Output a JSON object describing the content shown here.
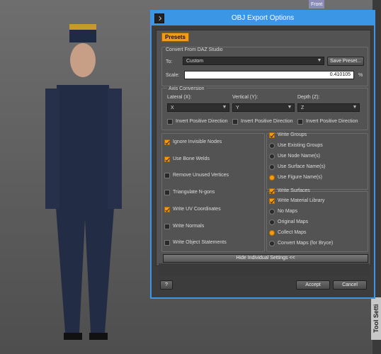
{
  "background": {
    "top_button_label": "Front",
    "side_tab_label": "Tool Setti"
  },
  "dialog": {
    "title": "OBJ Export Options",
    "presets_label": "Presets",
    "convert_group_label": "Convert From DAZ Studio",
    "to_label": "To:",
    "to_value": "Custom",
    "save_preset_label": "Save Preset...",
    "scale_label": "Scale:",
    "scale_value": "0.410105",
    "scale_unit": "%",
    "axis_group_label": "Axis Conversion",
    "lateral_label": "Lateral (X):",
    "vertical_label": "Vertical (Y):",
    "depth_label": "Depth (Z):",
    "lateral_value": "X",
    "vertical_value": "Y",
    "depth_value": "Z",
    "invert_label": "Invert Positive Direction",
    "options_left": [
      {
        "label": "Ignore Invisible Nodes",
        "checked": true
      },
      {
        "label": "Use Bone Welds",
        "checked": true
      },
      {
        "label": "Remove Unused Vertices",
        "checked": false
      },
      {
        "label": "Triangulate N-gons",
        "checked": false
      },
      {
        "label": "Write UV Coordinates",
        "checked": true
      },
      {
        "label": "Write Normals",
        "checked": false
      },
      {
        "label": "Write Object Statements",
        "checked": false
      }
    ],
    "write_groups_label": "Write Groups",
    "groups_radio": [
      {
        "label": "Use Existing Groups",
        "selected": false
      },
      {
        "label": "Use Node Name(s)",
        "selected": false
      },
      {
        "label": "Use Surface Name(s)",
        "selected": false
      },
      {
        "label": "Use Figure Name(s)",
        "selected": true
      }
    ],
    "write_surfaces_label": "Write Surfaces",
    "write_material_label": "Write Material Library",
    "maps_radio": [
      {
        "label": "No Maps",
        "selected": false
      },
      {
        "label": "Original Maps",
        "selected": false
      },
      {
        "label": "Collect Maps",
        "selected": true
      },
      {
        "label": "Convert Maps (for Bryce)",
        "selected": false
      }
    ],
    "hide_settings_label": "Hide Individual Settings <<",
    "help_label": "?",
    "accept_label": "Accept",
    "cancel_label": "Cancel",
    "accent_color": "#3c96e6",
    "highlight_color": "#f39c12"
  }
}
